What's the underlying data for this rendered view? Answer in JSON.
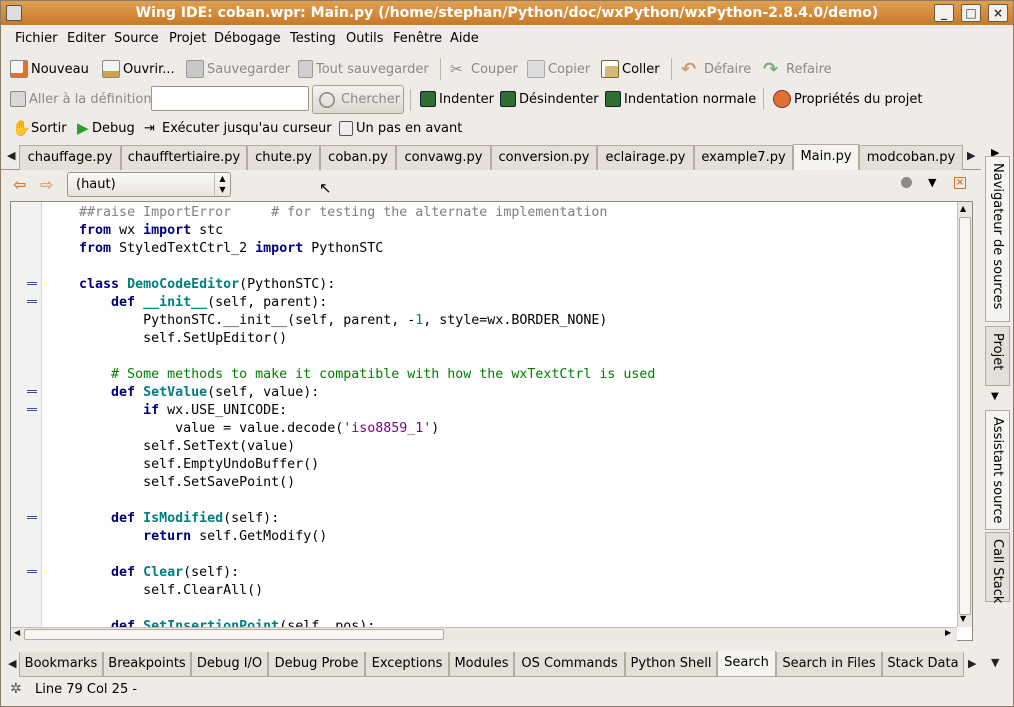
{
  "window": {
    "title": "Wing IDE: coban.wpr: Main.py (/home/stephan/Python/doc/wxPython/wxPython-2.8.4.0/demo)"
  },
  "menu": [
    "Fichier",
    "Editer",
    "Source",
    "Projet",
    "Débogage",
    "Testing",
    "Outils",
    "Fenêtre",
    "Aide"
  ],
  "toolbar1": {
    "new": "Nouveau",
    "open": "Ouvrir...",
    "save": "Sauvegarder",
    "save_all": "Tout sauvegarder",
    "cut": "Couper",
    "copy": "Copier",
    "paste": "Coller",
    "undo": "Défaire",
    "redo": "Refaire"
  },
  "toolbar2": {
    "goto_def": "Aller à la définition",
    "search_value": "",
    "search": "Chercher",
    "indent": "Indenter",
    "unindent": "Désindenter",
    "normal_indent": "Indentation normale",
    "project_props": "Propriétés du projet"
  },
  "toolbar3": {
    "stop": "Sortir",
    "debug": "Debug",
    "run_to_cursor": "Exécuter jusqu'au curseur",
    "step": "Un pas en avant"
  },
  "file_tabs": [
    "chauffage.py",
    "chaufftertiaire.py",
    "chute.py",
    "coban.py",
    "convawg.py",
    "conversion.py",
    "eclairage.py",
    "example7.py",
    "Main.py",
    "modcoban.py"
  ],
  "active_file_tab": "Main.py",
  "scope": "(haut)",
  "code_lines": [
    "    ##raise ImportError     # for testing the alternate implementation",
    "    from wx import stc",
    "    from StyledTextCtrl_2 import PythonSTC",
    "",
    "    class DemoCodeEditor(PythonSTC):",
    "        def __init__(self, parent):",
    "            PythonSTC.__init__(self, parent, -1, style=wx.BORDER_NONE)",
    "            self.SetUpEditor()",
    "",
    "        # Some methods to make it compatible with how the wxTextCtrl is used",
    "        def SetValue(self, value):",
    "            if wx.USE_UNICODE:",
    "                value = value.decode('iso8859_1')",
    "            self.SetText(value)",
    "            self.EmptyUndoBuffer()",
    "            self.SetSavePoint()",
    "",
    "        def IsModified(self):",
    "            return self.GetModify()",
    "",
    "        def Clear(self):",
    "            self.ClearAll()",
    "",
    "        def SetInsertionPoint(self, pos):"
  ],
  "side_tabs": [
    "Navigateur de sources",
    "Projet",
    "Assistant source",
    "Call Stack"
  ],
  "bottom_tabs": [
    "Bookmarks",
    "Breakpoints",
    "Debug I/O",
    "Debug Probe",
    "Exceptions",
    "Modules",
    "OS Commands",
    "Python Shell",
    "Search",
    "Search in Files",
    "Stack Data"
  ],
  "active_bottom_tab": "Search",
  "status": "Line 79 Col 25 -",
  "colors": {
    "titlebar": "#d08838",
    "keyword": "#00007f",
    "classname": "#007f7f",
    "comment_gray": "#7f7f7f",
    "comment_green": "#007f00",
    "string": "#7f007f"
  }
}
